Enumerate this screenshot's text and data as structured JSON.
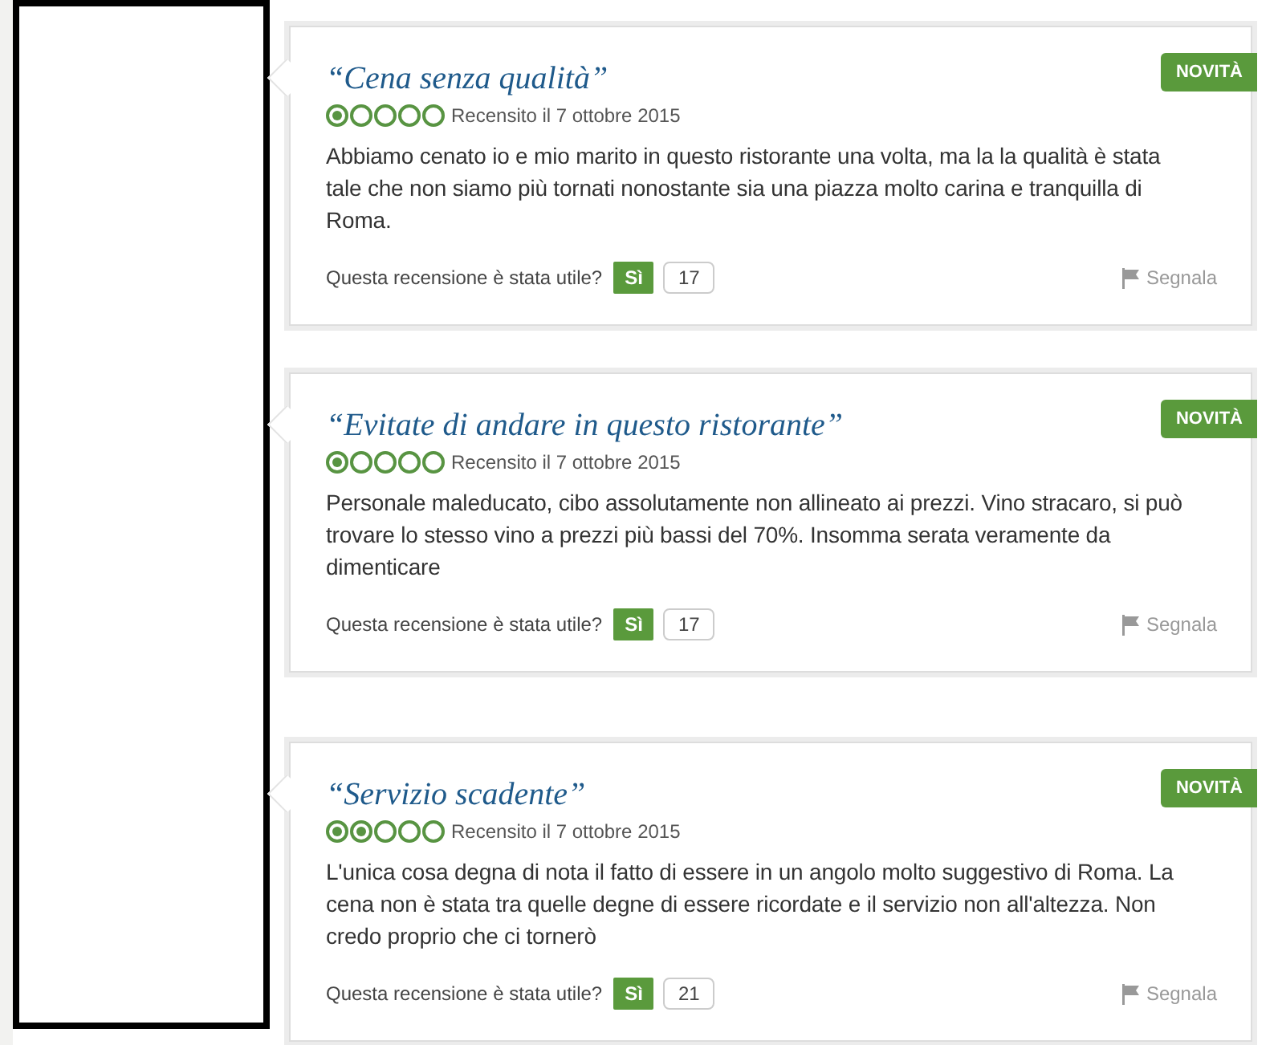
{
  "reviews": [
    {
      "title": "“Cena senza qualità”",
      "badge": "NOVITÀ",
      "stars": 1,
      "date": "Recensito il 7 ottobre 2015",
      "text": "Abbiamo cenato io e mio marito in questo ristorante una volta, ma la la qualità è stata tale che non siamo più tornati nonostante sia una piazza molto carina e tranquilla di Roma.",
      "helpful_prompt": "Questa recensione è stata utile?",
      "helpful_button": "Sì",
      "helpful_count": "17",
      "report": "Segnala"
    },
    {
      "title": "“Evitate di andare in questo ristorante”",
      "badge": "NOVITÀ",
      "stars": 1,
      "date": "Recensito il 7 ottobre 2015",
      "text": "Personale maleducato, cibo assolutamente non allineato ai prezzi. Vino stracaro, si può trovare lo stesso vino a prezzi più bassi del 70%. Insomma serata veramente da dimenticare",
      "helpful_prompt": "Questa recensione è stata utile?",
      "helpful_button": "Sì",
      "helpful_count": "17",
      "report": "Segnala"
    },
    {
      "title": "“Servizio scadente”",
      "badge": "NOVITÀ",
      "stars": 2,
      "date": "Recensito il 7 ottobre 2015",
      "text": "L'unica cosa degna di nota il fatto di essere in un angolo molto suggestivo di Roma. La cena non è stata tra quelle degne di essere ricordate e il servizio non all'altezza. Non credo proprio che ci tornerò",
      "helpful_prompt": "Questa recensione è stata utile?",
      "helpful_button": "Sì",
      "helpful_count": "21",
      "report": "Segnala"
    }
  ]
}
